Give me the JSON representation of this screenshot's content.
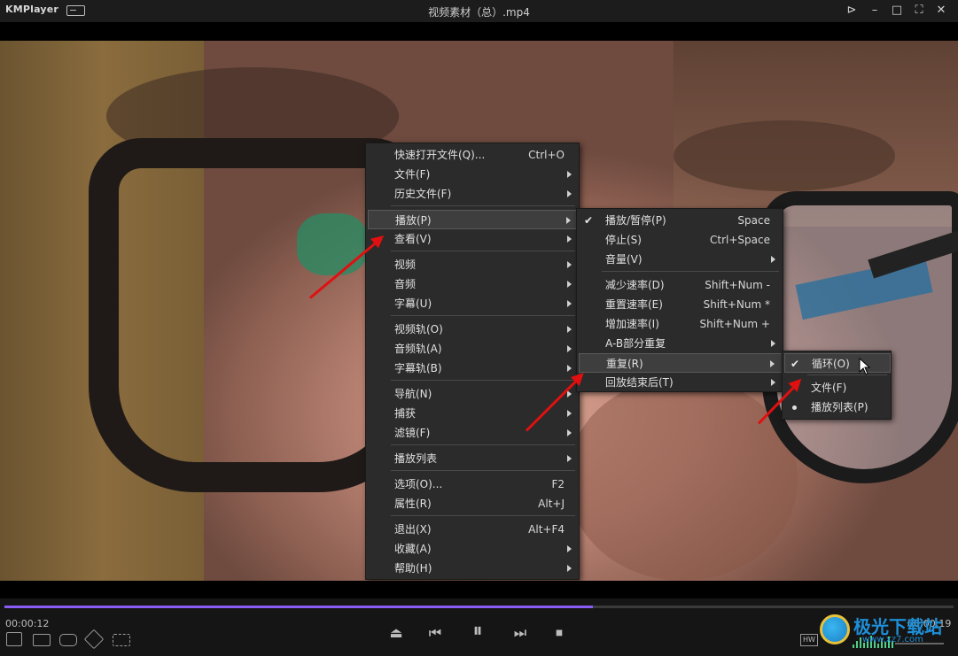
{
  "titlebar": {
    "brand": "KMPlayer",
    "title": "视频素材（总）.mp4"
  },
  "controls": {
    "elapsed": "00:00:12",
    "total": "00:00:19",
    "progress_fraction": 0.62,
    "hw_label": "HW"
  },
  "main_menu": {
    "items": [
      {
        "label": "快速打开文件(Q)...",
        "shortcut": "Ctrl+O"
      },
      {
        "label": "文件(F)",
        "submenu": true
      },
      {
        "label": "历史文件(F)",
        "submenu": true
      },
      {
        "label": "播放(P)",
        "submenu": true,
        "highlighted": true
      },
      {
        "label": "查看(V)",
        "submenu": true
      },
      {
        "label": "视频",
        "submenu": true
      },
      {
        "label": "音频",
        "submenu": true
      },
      {
        "label": "字幕(U)",
        "submenu": true
      },
      {
        "label": "视频轨(O)",
        "submenu": true
      },
      {
        "label": "音频轨(A)",
        "submenu": true
      },
      {
        "label": "字幕轨(B)",
        "submenu": true
      },
      {
        "label": "导航(N)",
        "submenu": true
      },
      {
        "label": "捕获",
        "submenu": true
      },
      {
        "label": "滤镜(F)",
        "submenu": true
      },
      {
        "label": "播放列表",
        "submenu": true
      },
      {
        "label": "选项(O)...",
        "shortcut": "F2"
      },
      {
        "label": "属性(R)",
        "shortcut": "Alt+J"
      },
      {
        "label": "退出(X)",
        "shortcut": "Alt+F4"
      },
      {
        "label": "收藏(A)",
        "submenu": true
      },
      {
        "label": "帮助(H)",
        "submenu": true
      }
    ]
  },
  "play_menu": {
    "items": [
      {
        "label": "播放/暂停(P)",
        "shortcut": "Space",
        "checked": true
      },
      {
        "label": "停止(S)",
        "shortcut": "Ctrl+Space"
      },
      {
        "label": "音量(V)",
        "submenu": true
      },
      {
        "label": "减少速率(D)",
        "shortcut": "Shift+Num -"
      },
      {
        "label": "重置速率(E)",
        "shortcut": "Shift+Num *"
      },
      {
        "label": "增加速率(I)",
        "shortcut": "Shift+Num +"
      },
      {
        "label": "A-B部分重复",
        "submenu": true
      },
      {
        "label": "重复(R)",
        "submenu": true,
        "highlighted": true
      },
      {
        "label": "回放结束后(T)",
        "submenu": true
      }
    ]
  },
  "repeat_menu": {
    "items": [
      {
        "label": "循环(O)",
        "checked": true,
        "highlighted": true
      },
      {
        "label": "文件(F)"
      },
      {
        "label": "播放列表(P)",
        "radio": true
      }
    ]
  },
  "watermark": {
    "text": "极光下载站",
    "url": "www.xz7.com"
  },
  "colors": {
    "accent": "#8a5cf6",
    "arrow": "#e01010",
    "menu_bg": "#2b2b2b"
  }
}
